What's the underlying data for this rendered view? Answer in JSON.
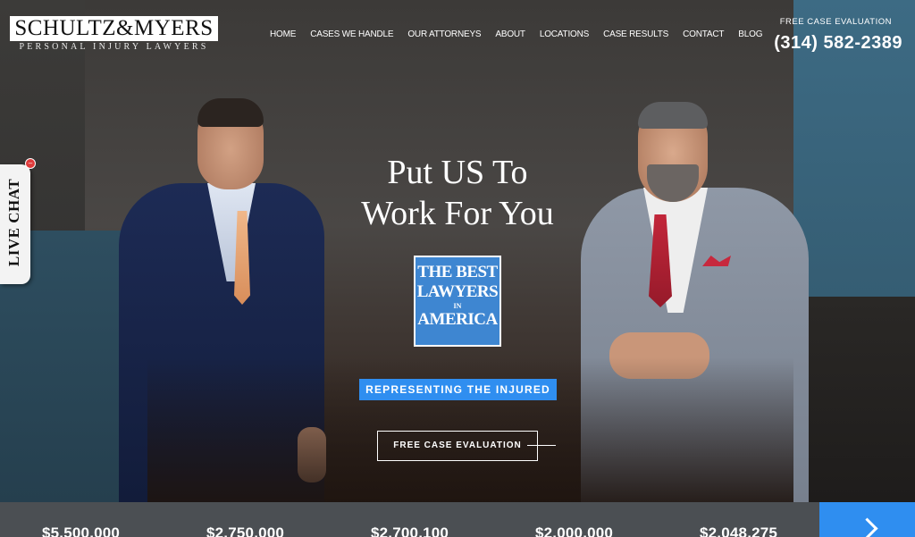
{
  "logo": {
    "main": "SCHULTZ&MYERS",
    "sub": "PERSONAL INJURY LAWYERS"
  },
  "nav": [
    {
      "label": "HOME"
    },
    {
      "label": "CASES WE HANDLE"
    },
    {
      "label": "OUR ATTORNEYS"
    },
    {
      "label": "ABOUT"
    },
    {
      "label": "LOCATIONS"
    },
    {
      "label": "CASE RESULTS"
    },
    {
      "label": "CONTACT"
    },
    {
      "label": "BLOG"
    }
  ],
  "contact": {
    "label": "FREE CASE EVALUATION",
    "phone": "(314) 582-2389"
  },
  "hero": {
    "headline_line1": "Put US To",
    "headline_line2": "Work For You",
    "badge": {
      "line1": "THE BEST",
      "line2": "LAWYERS",
      "line3": "IN",
      "line4": "AMERICA"
    },
    "tagline": "REPRESENTING THE INJURED",
    "cta": "FREE CASE EVALUATION"
  },
  "livechat": {
    "label": "LIVE CHAT"
  },
  "results": [
    {
      "amount": "$5,500,000"
    },
    {
      "amount": "$2,750,000"
    },
    {
      "amount": "$2,700,100"
    },
    {
      "amount": "$2,000,000"
    },
    {
      "amount": "$2,048,275"
    }
  ],
  "colors": {
    "accent": "#2f8ef0",
    "badge": "#3e86d1",
    "results_bar": "#4b4f53"
  }
}
